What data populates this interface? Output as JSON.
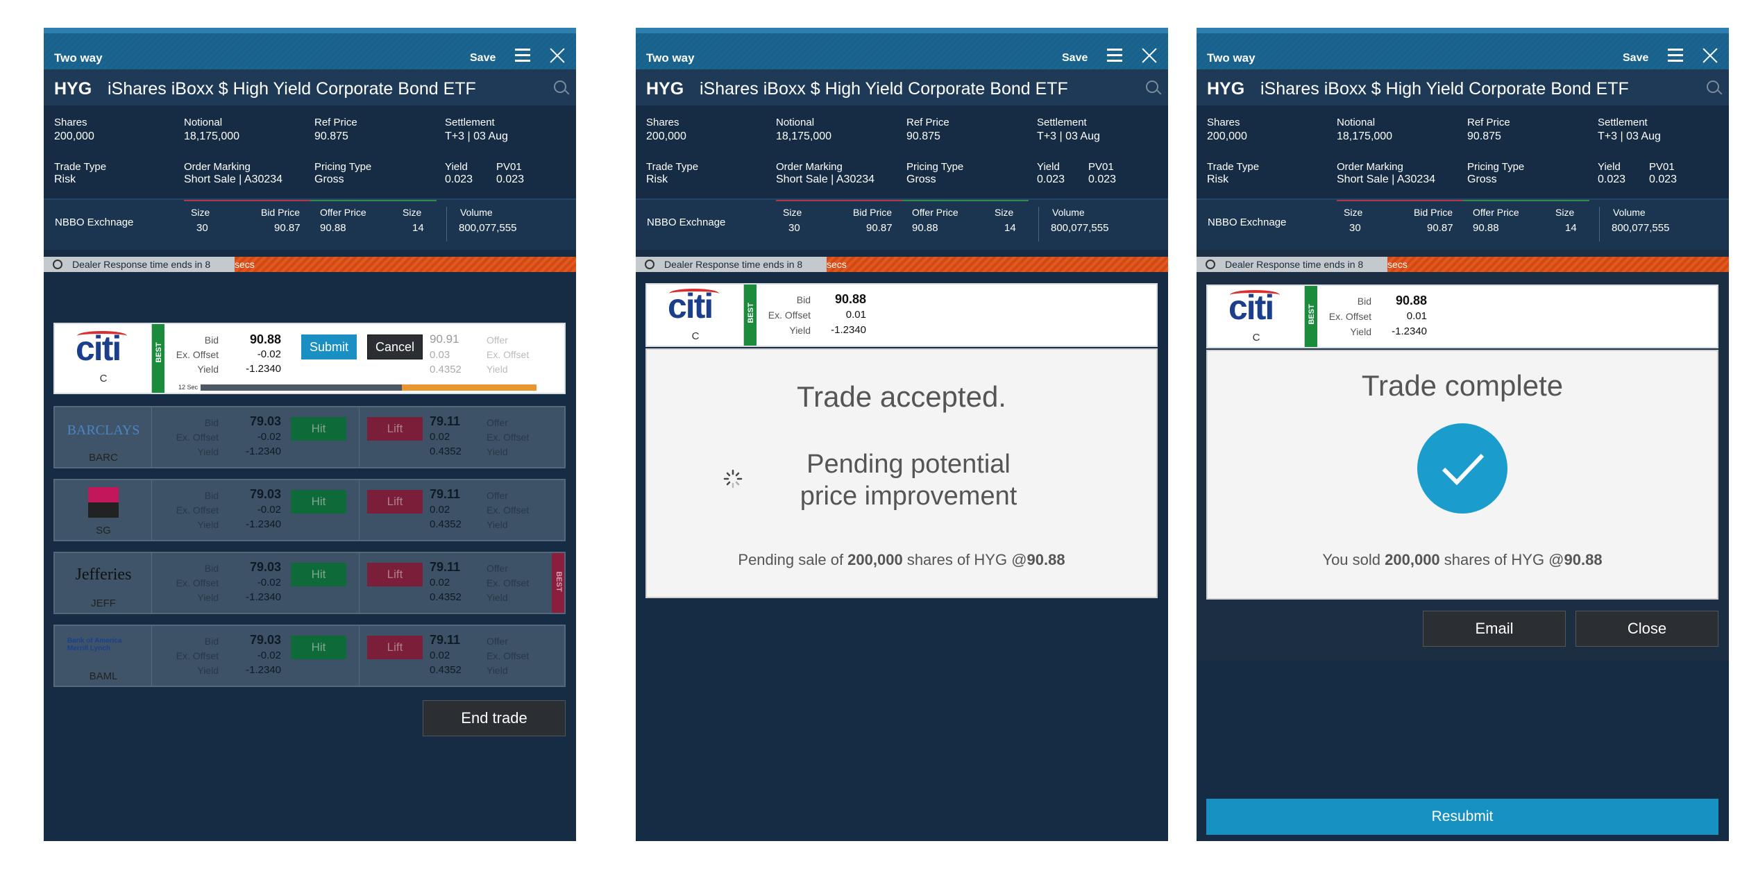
{
  "header": {
    "title": "Two way",
    "save": "Save"
  },
  "security": {
    "ticker": "HYG",
    "name": "iShares iBoxx $ High Yield Corporate Bond ETF"
  },
  "info": {
    "shares_label": "Shares",
    "shares": "200,000",
    "notional_label": "Notional",
    "notional": "18,175,000",
    "ref_label": "Ref Price",
    "ref": "90.875",
    "settle_label": "Settlement",
    "settle": "T+3 | 03 Aug",
    "tradetype_label": "Trade Type",
    "tradetype": "Risk",
    "ordermark_label": "Order Marking",
    "ordermark": "Short Sale | A30234",
    "pricing_label": "Pricing Type",
    "pricing": "Gross",
    "yield_label": "Yield",
    "yield": "0.023",
    "pv01_label": "PV01",
    "pv01": "0.023"
  },
  "nbbo": {
    "label": "NBBO Exchnage",
    "size_label": "Size",
    "bid_label": "Bid Price",
    "offer_label": "Offer Price",
    "size2_label": "Size",
    "volume_label": "Volume",
    "bid_size": "30",
    "bid": "90.87",
    "offer": "90.88",
    "offer_size": "14",
    "volume": "800,077,555"
  },
  "timer": {
    "text": "Dealer Response time ends in 8 ",
    "secs": "secs"
  },
  "labels": {
    "bid": "Bid",
    "offset": "Ex. Offset",
    "yield": "Yield",
    "offer": "Offer",
    "best": "BEST"
  },
  "citi": {
    "logo": "citi",
    "code": "C",
    "bid": "90.88",
    "offset": "-0.02",
    "yield": "-1.2340",
    "offer": "90.91",
    "offer_offset": "0.03",
    "offer_yield": "0.4352",
    "submit": "Submit",
    "cancel": "Cancel",
    "timer": "12 Sec",
    "progress": 0.6
  },
  "dealers": [
    {
      "logo": "BARCLAYS",
      "code": "BARC",
      "bid": "79.03",
      "offset": "-0.02",
      "yield": "-1.2340",
      "offer": "79.11",
      "offer_offset": "0.02",
      "offer_yield": "0.4352"
    },
    {
      "logo": "",
      "code": "SG",
      "bid": "79.03",
      "offset": "-0.02",
      "yield": "-1.2340",
      "offer": "79.11",
      "offer_offset": "0.02",
      "offer_yield": "0.4352"
    },
    {
      "logo": "Jefferies",
      "code": "JEFF",
      "bid": "79.03",
      "offset": "-0.02",
      "yield": "-1.2340",
      "offer": "79.11",
      "offer_offset": "0.02",
      "offer_yield": "0.4352"
    },
    {
      "logo": "Bank of America Merrill Lynch",
      "code": "BAML",
      "bid": "79.03",
      "offset": "-0.02",
      "yield": "-1.2340",
      "offer": "79.11",
      "offer_offset": "0.02",
      "offer_yield": "0.4352"
    }
  ],
  "hit": "Hit",
  "lift": "Lift",
  "end_trade": "End trade",
  "panel2": {
    "bid": "90.88",
    "offset": "0.01",
    "yield": "-1.2340",
    "title": "Trade accepted.",
    "pending1": "Pending potential",
    "pending2": "price improvement",
    "msg_pre": "Pending sale of ",
    "msg_qty": "200,000",
    "msg_mid": " shares of HYG @",
    "msg_px": "90.88"
  },
  "panel3": {
    "bid": "90.88",
    "offset": "0.01",
    "yield": "-1.2340",
    "title": "Trade complete",
    "msg_pre": "You sold ",
    "msg_qty": "200,000",
    "msg_mid": " shares of HYG @",
    "msg_px": "90.88",
    "email": "Email",
    "close": "Close",
    "resubmit": "Resubmit"
  },
  "colors": {
    "brand": "#17618e",
    "hit": "#0f6a3a",
    "lift": "#7a1e3a",
    "submit": "#1a8fc4",
    "check": "#1a9ccc"
  }
}
